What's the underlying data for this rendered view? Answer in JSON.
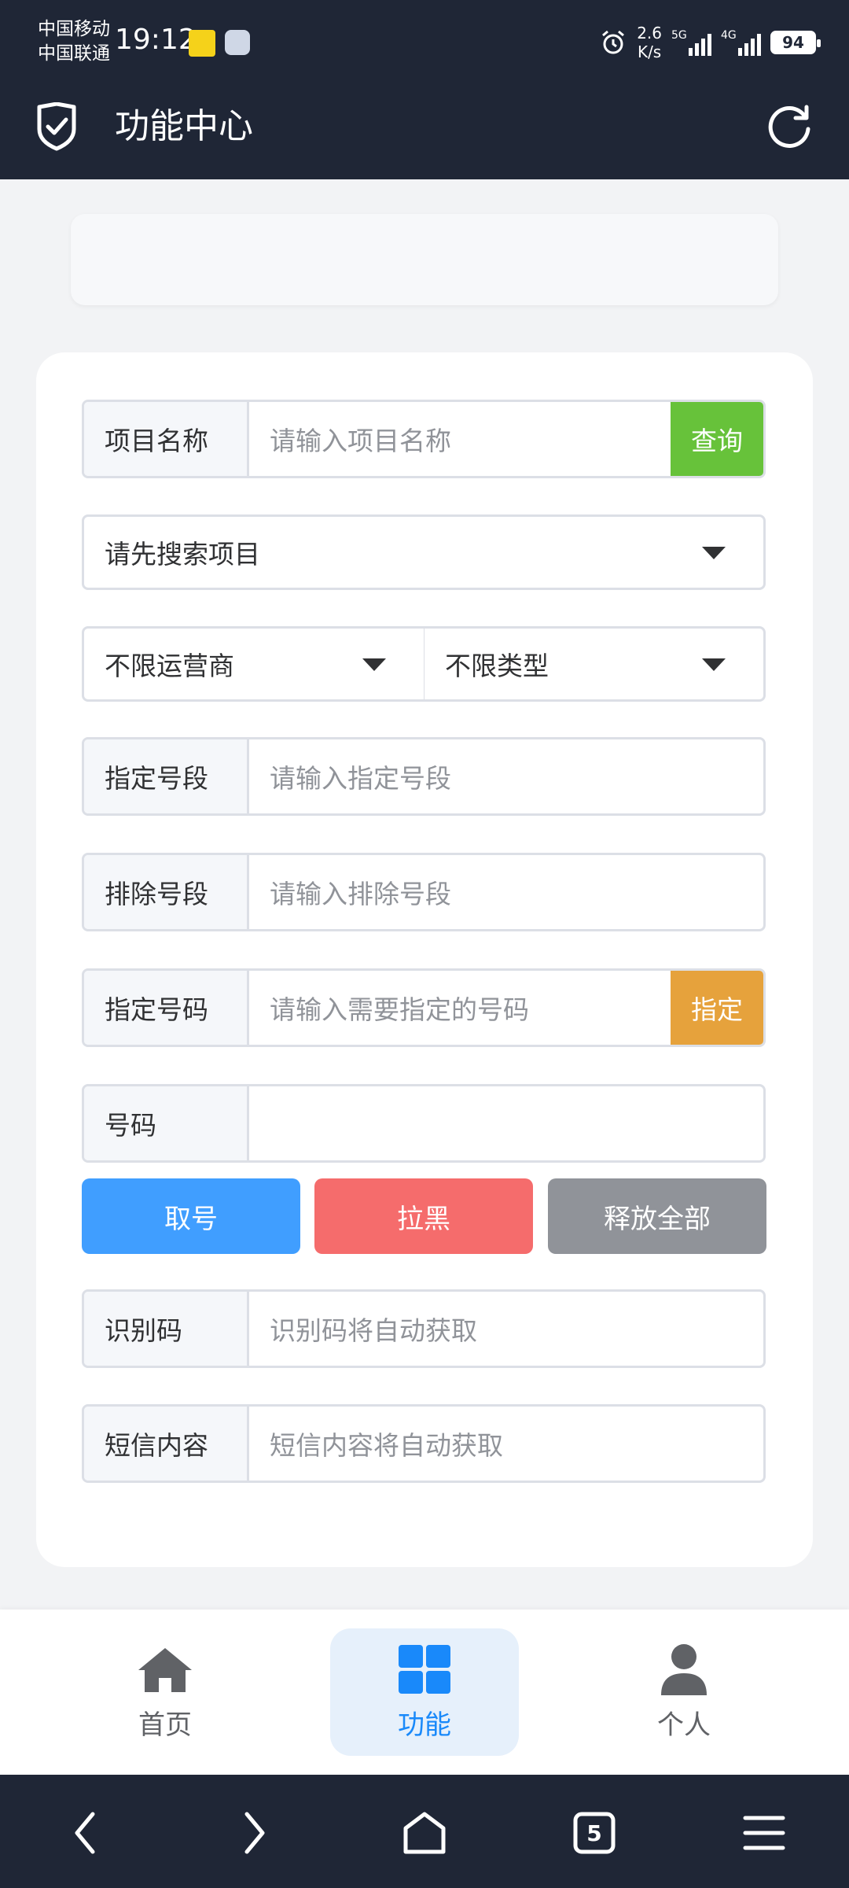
{
  "status_bar": {
    "carrier_1": "中国移动",
    "carrier_2": "中国联通",
    "time": "19:12",
    "net_speed_value": "2.6",
    "net_speed_unit": "K/s",
    "signal_1_type": "5G",
    "signal_2_type": "4G",
    "battery": "94"
  },
  "header": {
    "title": "功能中心",
    "logo_icon": "shield-check-icon",
    "refresh_icon": "refresh-icon"
  },
  "form": {
    "project": {
      "label": "项目名称",
      "placeholder": "请输入项目名称",
      "button": "查询"
    },
    "project_select": {
      "value": "请先搜索项目"
    },
    "operator_select": {
      "value": "不限运营商"
    },
    "type_select": {
      "value": "不限类型"
    },
    "include_segment": {
      "label": "指定号段",
      "placeholder": "请输入指定号段"
    },
    "exclude_segment": {
      "label": "排除号段",
      "placeholder": "请输入排除号段"
    },
    "specify_number": {
      "label": "指定号码",
      "placeholder": "请输入需要指定的号码",
      "button": "指定"
    },
    "number": {
      "label": "号码",
      "value": ""
    },
    "buttons": {
      "get": "取号",
      "blacklist": "拉黑",
      "release_all": "释放全部"
    },
    "code": {
      "label": "识别码",
      "placeholder": "识别码将自动获取"
    },
    "sms": {
      "label": "短信内容",
      "placeholder": "短信内容将自动获取"
    }
  },
  "tabs": [
    {
      "label": "首页",
      "icon": "home-icon",
      "active": false
    },
    {
      "label": "功能",
      "icon": "grid-icon",
      "active": true
    },
    {
      "label": "个人",
      "icon": "user-icon",
      "active": false
    }
  ],
  "browser_nav": {
    "tab_count": "5"
  },
  "colors": {
    "header_bg": "#1f2636",
    "primary": "#409eff",
    "success": "#67c23a",
    "warning": "#e6a23c",
    "danger": "#f56c6c",
    "info": "#909399"
  }
}
